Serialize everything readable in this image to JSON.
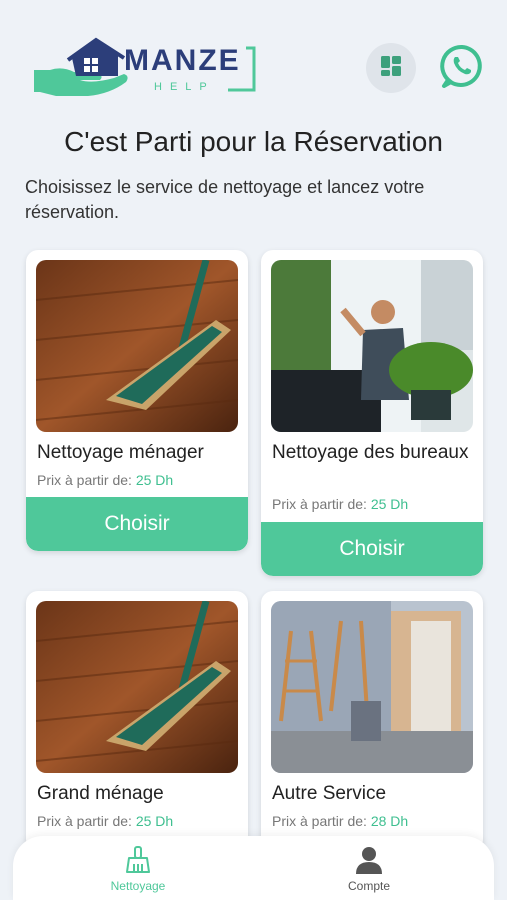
{
  "header": {
    "logo_text_main": "MANZE",
    "logo_text_sub": "HELP",
    "grid_icon": "grid-icon",
    "whatsapp_icon": "whatsapp-icon"
  },
  "page": {
    "title": "C'est Parti pour la Réservation",
    "subtitle": "Choisissez le service de nettoyage et lancez votre réservation."
  },
  "services": [
    {
      "name": "Nettoyage ménager",
      "price_label": "Prix à partir de:",
      "price": "25 Dh",
      "button": "Choisir"
    },
    {
      "name": "Nettoyage des bureaux",
      "price_label": "Prix à partir de:",
      "price": "25 Dh",
      "button": "Choisir"
    },
    {
      "name": "Grand ménage",
      "price_label": "Prix à partir de:",
      "price": "25 Dh"
    },
    {
      "name": "Autre Service",
      "price_label": "Prix à partir de:",
      "price": "28 Dh"
    }
  ],
  "tabs": [
    {
      "label": "Nettoyage",
      "icon": "broom-icon",
      "active": true
    },
    {
      "label": "Compte",
      "icon": "user-icon",
      "active": false
    }
  ],
  "colors": {
    "accent": "#4fc89a",
    "brand_dark": "#2c3e7a",
    "background": "#eef2f7"
  }
}
